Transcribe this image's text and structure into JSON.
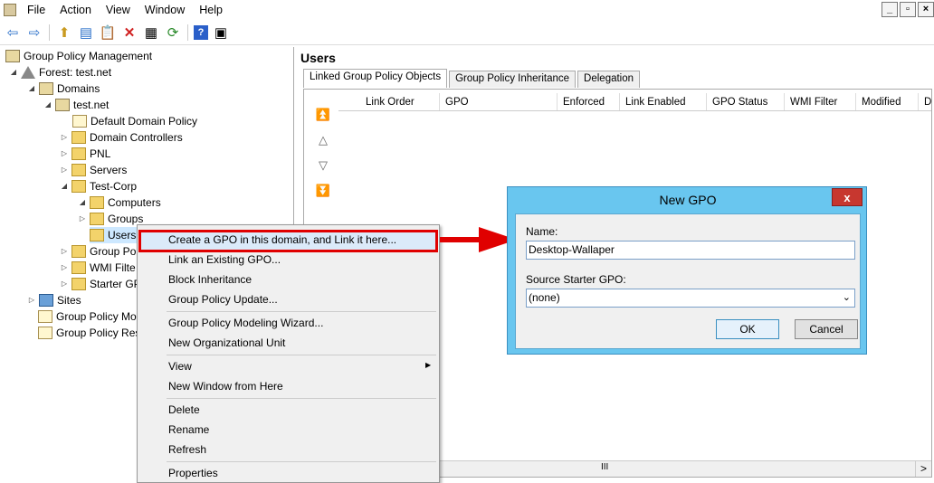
{
  "menu": [
    "File",
    "Action",
    "View",
    "Window",
    "Help"
  ],
  "tree": {
    "root": "Group Policy Management",
    "forest": "Forest: test.net",
    "domains": "Domains",
    "domain": "test.net",
    "ddp": "Default Domain Policy",
    "dc": "Domain Controllers",
    "pnl": "PNL",
    "servers": "Servers",
    "testcorp": "Test-Corp",
    "computers": "Computers",
    "groups": "Groups",
    "users": "Users",
    "gpo": "Group Po",
    "wmi": "WMI Filte",
    "starter": "Starter GP",
    "sites": "Sites",
    "modeling": "Group Policy Mo",
    "results": "Group Policy Res"
  },
  "right": {
    "title": "Users",
    "tabs": [
      "Linked Group Policy Objects",
      "Group Policy Inheritance",
      "Delegation"
    ],
    "columns": [
      "Link Order",
      "GPO",
      "Enforced",
      "Link Enabled",
      "GPO Status",
      "WMI Filter",
      "Modified",
      "D"
    ],
    "scroll_mid": "III",
    "scroll_right": ">"
  },
  "context_menu": [
    "Create a GPO in this domain, and Link it here...",
    "Link an Existing GPO...",
    "Block Inheritance",
    "Group Policy Update...",
    "Group Policy Modeling Wizard...",
    "New Organizational Unit",
    "View",
    "New Window from Here",
    "Delete",
    "Rename",
    "Refresh",
    "Properties"
  ],
  "dialog": {
    "title": "New GPO",
    "close": "x",
    "name_label": "Name:",
    "name_value": "Desktop-Wallaper",
    "starter_label": "Source Starter GPO:",
    "starter_value": "(none)",
    "ok": "OK",
    "cancel": "Cancel"
  }
}
